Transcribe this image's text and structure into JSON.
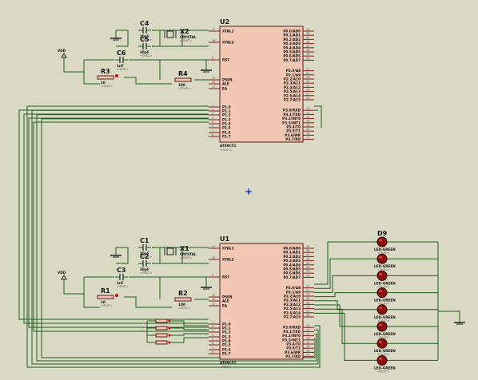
{
  "schematic": {
    "u2": {
      "ref": "U2",
      "part": "AT89C51",
      "text_tag": "<TEXT>",
      "left_pins": [
        {
          "num": "19",
          "name": "XTAL1"
        },
        {
          "num": "18",
          "name": "XTAL2"
        },
        {
          "num": "9",
          "name": "RST"
        },
        {
          "num": "29",
          "name": "PSEN"
        },
        {
          "num": "30",
          "name": "ALE"
        },
        {
          "num": "31",
          "name": "EA"
        },
        {
          "num": "1",
          "name": "P1.0"
        },
        {
          "num": "2",
          "name": "P1.1"
        },
        {
          "num": "3",
          "name": "P1.2"
        },
        {
          "num": "4",
          "name": "P1.3"
        },
        {
          "num": "5",
          "name": "P1.4"
        },
        {
          "num": "6",
          "name": "P1.5"
        },
        {
          "num": "7",
          "name": "P1.6"
        },
        {
          "num": "8",
          "name": "P1.7"
        }
      ],
      "right_pins": [
        {
          "num": "39",
          "name": "P0.0/AD0"
        },
        {
          "num": "38",
          "name": "P0.1/AD1"
        },
        {
          "num": "37",
          "name": "P0.2/AD2"
        },
        {
          "num": "36",
          "name": "P0.3/AD3"
        },
        {
          "num": "35",
          "name": "P0.4/AD4"
        },
        {
          "num": "34",
          "name": "P0.5/AD5"
        },
        {
          "num": "33",
          "name": "P0.6/AD6"
        },
        {
          "num": "32",
          "name": "P0.7/AD7"
        },
        {
          "num": "21",
          "name": "P2.0/A8"
        },
        {
          "num": "22",
          "name": "P2.1/A9"
        },
        {
          "num": "23",
          "name": "P2.2/A10"
        },
        {
          "num": "24",
          "name": "P2.3/A11"
        },
        {
          "num": "25",
          "name": "P2.4/A12"
        },
        {
          "num": "26",
          "name": "P2.5/A13"
        },
        {
          "num": "27",
          "name": "P2.6/A14"
        },
        {
          "num": "28",
          "name": "P2.7/A15"
        },
        {
          "num": "10",
          "name": "P3.0/RXD"
        },
        {
          "num": "11",
          "name": "P3.1/TXD"
        },
        {
          "num": "12",
          "name": "P3.2/INT0"
        },
        {
          "num": "13",
          "name": "P3.3/INT1"
        },
        {
          "num": "14",
          "name": "P3.4/T0"
        },
        {
          "num": "15",
          "name": "P3.5/T1"
        },
        {
          "num": "16",
          "name": "P3.6/WR"
        },
        {
          "num": "17",
          "name": "P3.7/RD"
        }
      ]
    },
    "u1": {
      "ref": "U1",
      "part": "AT89C51",
      "text_tag": "<TEXT>"
    },
    "components": {
      "c4": {
        "ref": "C4",
        "value": "30pF",
        "tag": "<TEXT>"
      },
      "c5": {
        "ref": "C5",
        "value": "30pF",
        "tag": "<TEXT>"
      },
      "x2": {
        "ref": "X2",
        "value": "CRYSTAL",
        "tag": "<TEXT>"
      },
      "c6": {
        "ref": "C6",
        "value": "1nF",
        "tag": "<TEXT>"
      },
      "r3": {
        "ref": "R3",
        "value": "10",
        "tag": "<TEXT>"
      },
      "r4": {
        "ref": "R4",
        "value": "100",
        "tag": "<TEXT>"
      },
      "c1": {
        "ref": "C1",
        "value": "30pF",
        "tag": "<TEXT>"
      },
      "c2": {
        "ref": "C2",
        "value": "30pF",
        "tag": "<TEXT>"
      },
      "x1": {
        "ref": "X1",
        "value": "CRYSTAL",
        "tag": "<TEXT>"
      },
      "c3": {
        "ref": "C3",
        "value": "1nF",
        "tag": "<TEXT>"
      },
      "r1": {
        "ref": "R1",
        "value": "10",
        "tag": "<TEXT>"
      },
      "r2": {
        "ref": "R2",
        "value": "100",
        "tag": "<TEXT>"
      }
    },
    "vdd_label": "VDD",
    "led_first_ref": "D9",
    "led_value": "LED-GREEN",
    "led_tag": "<TEXT>",
    "led_count": 8,
    "switch_count": 4,
    "colors": {
      "background": "#d9d9c4",
      "chip_fill": "#f0c8b4",
      "chip_border": "#5a1a1a",
      "wire": "#1c5e1c",
      "pin": "#8b1a1a",
      "led": "#8b1010",
      "origin_marker": "#1a3cc8"
    }
  }
}
